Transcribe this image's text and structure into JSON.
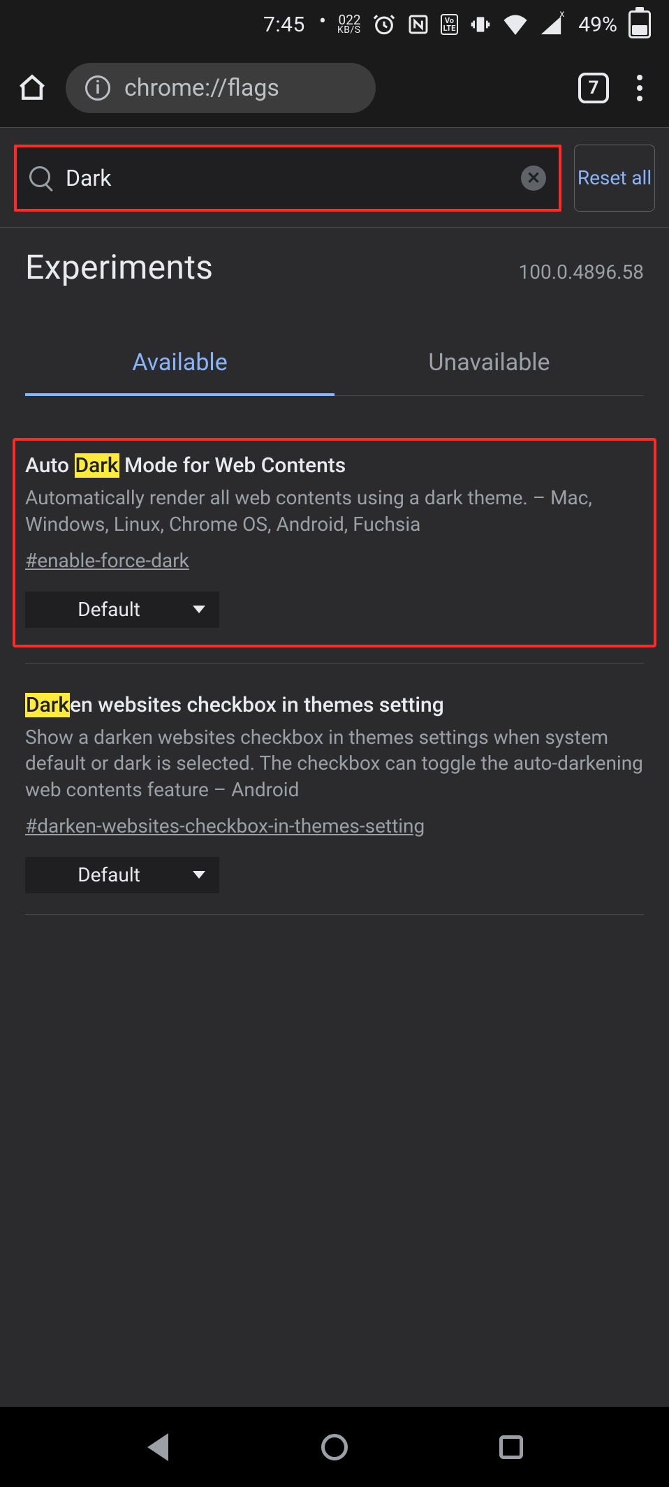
{
  "status": {
    "time": "7:45",
    "speed_value": "022",
    "speed_unit": "KB/S",
    "volte_label": "VoLTE",
    "battery_pct": "49%"
  },
  "chrome": {
    "url": "chrome://flags",
    "tab_count": "7"
  },
  "search": {
    "value": "Dark",
    "reset_label": "Reset all"
  },
  "header": {
    "title": "Experiments",
    "version": "100.0.4896.58"
  },
  "tabs": {
    "available": "Available",
    "unavailable": "Unavailable"
  },
  "flags": [
    {
      "title_pre": "Auto ",
      "title_hl": "Dark",
      "title_post": " Mode for Web Contents",
      "desc": "Automatically render all web contents using a dark theme. – Mac, Windows, Linux, Chrome OS, Android, Fuchsia",
      "hash": "#enable-force-dark",
      "select": "Default"
    },
    {
      "title_pre": "",
      "title_hl": "Dark",
      "title_post": "en websites checkbox in themes setting",
      "desc": "Show a darken websites checkbox in themes settings when system default or dark is selected. The checkbox can toggle the auto-darkening web contents feature – Android",
      "hash": "#darken-websites-checkbox-in-themes-setting",
      "select": "Default"
    }
  ]
}
